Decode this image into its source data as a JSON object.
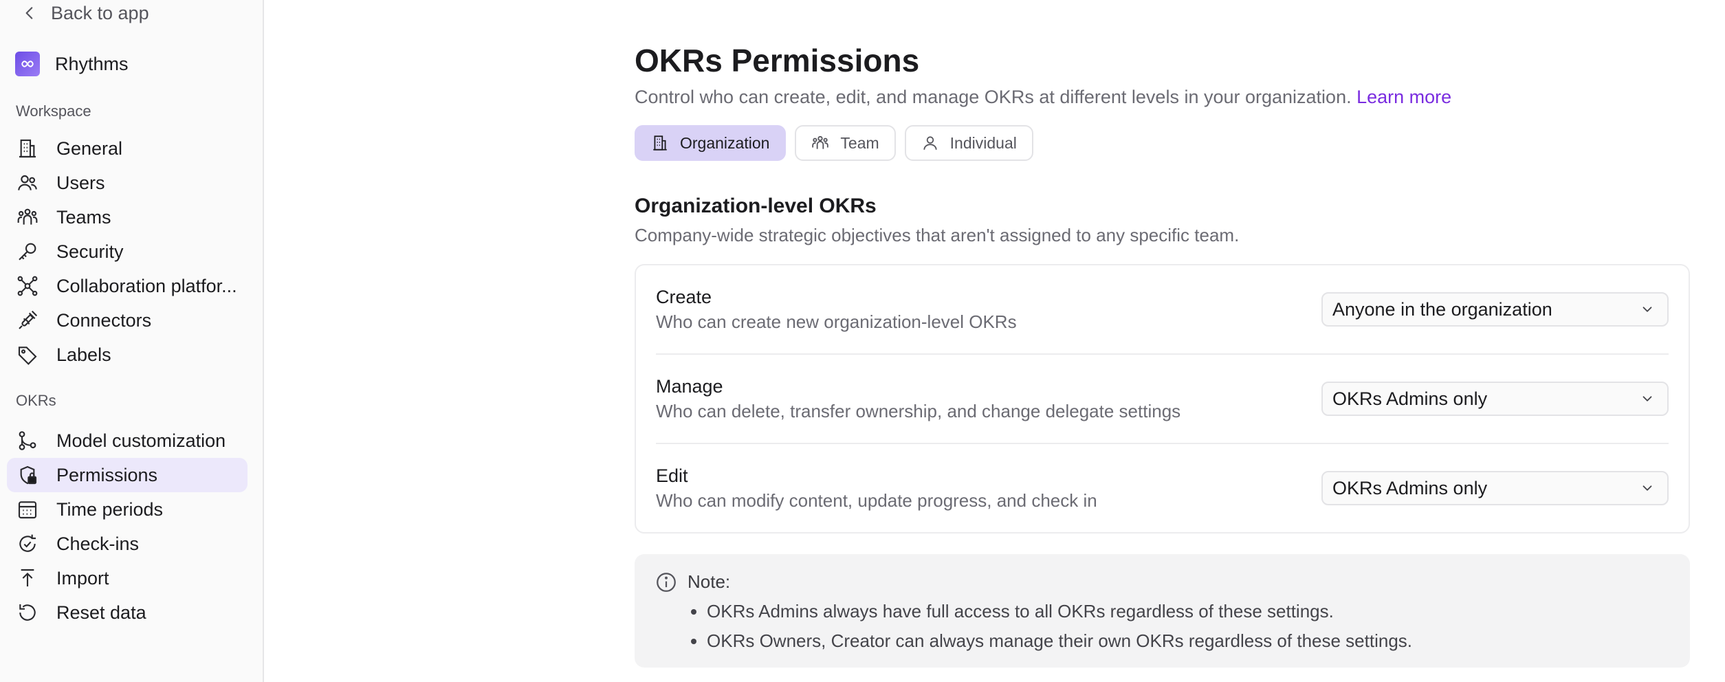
{
  "sidebar": {
    "back_label": "Back to app",
    "brand": "Rhythms",
    "workspace_label": "Workspace",
    "workspace_items": [
      {
        "label": "General",
        "icon": "building-icon"
      },
      {
        "label": "Users",
        "icon": "users-icon"
      },
      {
        "label": "Teams",
        "icon": "teams-icon"
      },
      {
        "label": "Security",
        "icon": "key-icon"
      },
      {
        "label": "Collaboration platfor...",
        "icon": "network-icon"
      },
      {
        "label": "Connectors",
        "icon": "plug-icon"
      },
      {
        "label": "Labels",
        "icon": "tag-icon"
      }
    ],
    "okrs_label": "OKRs",
    "okrs_items": [
      {
        "label": "Model customization",
        "icon": "branch-icon"
      },
      {
        "label": "Permissions",
        "icon": "shield-lock-icon",
        "active": true
      },
      {
        "label": "Time periods",
        "icon": "calendar-icon"
      },
      {
        "label": "Check-ins",
        "icon": "refresh-check-icon"
      },
      {
        "label": "Import",
        "icon": "upload-icon"
      },
      {
        "label": "Reset data",
        "icon": "reset-icon"
      }
    ]
  },
  "main": {
    "title": "OKRs Permissions",
    "subtitle": "Control who can create, edit, and manage OKRs at different levels in your organization.",
    "learn_more": "Learn more",
    "tabs": [
      {
        "label": "Organization",
        "icon": "building-icon",
        "active": true
      },
      {
        "label": "Team",
        "icon": "teams-icon"
      },
      {
        "label": "Individual",
        "icon": "person-icon"
      }
    ],
    "section": {
      "title": "Organization-level OKRs",
      "subtitle": "Company-wide strategic objectives that aren't assigned to any specific team."
    },
    "permissions": [
      {
        "title": "Create",
        "desc": "Who can create new organization-level OKRs",
        "value": "Anyone in the organization"
      },
      {
        "title": "Manage",
        "desc": "Who can delete, transfer ownership, and change delegate settings",
        "value": "OKRs Admins only"
      },
      {
        "title": "Edit",
        "desc": "Who can modify content, update progress, and check in",
        "value": "OKRs Admins only"
      }
    ],
    "note": {
      "title": "Note:",
      "items": [
        "OKRs Admins always have full access to all OKRs regardless of these settings.",
        "OKRs Owners, Creator can always manage their own OKRs regardless of these settings."
      ]
    }
  },
  "colors": {
    "accent": "#7a2ce0",
    "active_tab_bg": "#d9d2f6",
    "active_nav_bg": "#ece8fb"
  }
}
